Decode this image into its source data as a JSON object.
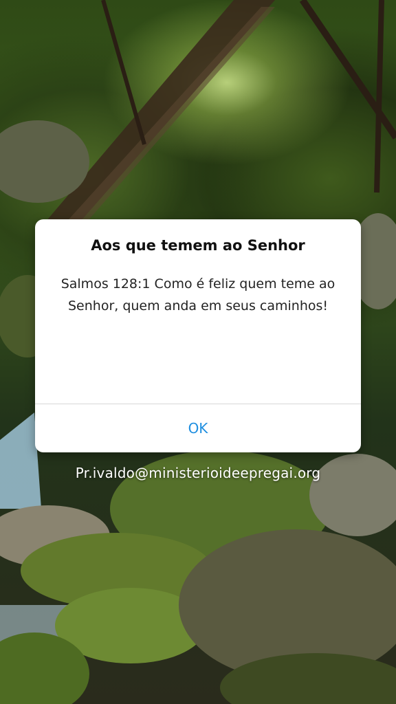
{
  "dialog": {
    "title": "Aos que temem ao Senhor",
    "message": "Salmos 128:1 Como é feliz quem teme ao Senhor, quem anda em seus caminhos!",
    "ok_label": "OK"
  },
  "background": {
    "watermark": "Pr.ivaldo@ministerioideepregai.org"
  },
  "colors": {
    "accent": "#1f8fe0",
    "dialog_bg": "#ffffff"
  }
}
